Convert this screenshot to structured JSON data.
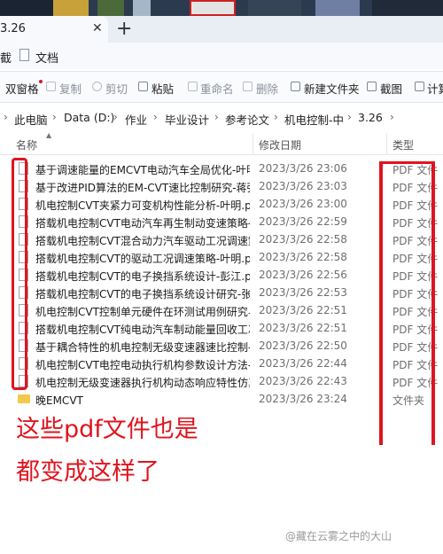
{
  "tab": {
    "title": "3.26",
    "close_glyph": "✕",
    "new_glyph": "+"
  },
  "quick": {
    "item1": "截",
    "item2": "文档"
  },
  "toolbar": {
    "items": [
      {
        "label": "双窗格"
      },
      {
        "label": "复制"
      },
      {
        "label": "剪切"
      },
      {
        "label": "粘贴"
      },
      {
        "label": "重命名"
      },
      {
        "label": "删除"
      },
      {
        "label": "新建文件夹"
      },
      {
        "label": "截图"
      },
      {
        "label": "计算"
      }
    ]
  },
  "address": {
    "parts": [
      "此电脑",
      "Data (D:)",
      "作业",
      "毕业设计",
      "参考论文",
      "机电控制-中",
      "3.26"
    ],
    "separator": "›"
  },
  "columns": {
    "name": "名称",
    "modified": "修改日期",
    "type": "类型"
  },
  "files": [
    {
      "name": "基于调速能量的EMCVT电动汽车全局优化-叶明...",
      "date": "2023/3/26 23:06",
      "type": "PDF 文件"
    },
    {
      "name": "基于改进PID算法的EM-CVT速比控制研究-蒋强...",
      "date": "2023/3/26 23:03",
      "type": "PDF 文件"
    },
    {
      "name": "机电控制CVT夹紧力可变机构性能分析-叶明.pdf",
      "date": "2023/3/26 23:00",
      "type": "PDF 文件"
    },
    {
      "name": "搭载机电控制CVT电动汽车再生制动变速策略-...",
      "date": "2023/3/26 22:59",
      "type": "PDF 文件"
    },
    {
      "name": "搭载机电控制CVT混合动力汽车驱动工况调速策...",
      "date": "2023/3/26 22:58",
      "type": "PDF 文件"
    },
    {
      "name": "搭载机电控制CVT的驱动工况调速策略-叶明.pdf",
      "date": "2023/3/26 22:58",
      "type": "PDF 文件"
    },
    {
      "name": "搭载机电控制CVT的电子换挡系统设计-彭江.pdf",
      "date": "2023/3/26 22:56",
      "type": "PDF 文件"
    },
    {
      "name": "搭载机电控制CVT的电子换挡系统设计研究-张...",
      "date": "2023/3/26 22:53",
      "type": "PDF 文件"
    },
    {
      "name": "机电控制CVT控制单元硬件在环测试用例研究与...",
      "date": "2023/3/26 22:51",
      "type": "PDF 文件"
    },
    {
      "name": "搭载机电控制CVT纯电动汽车制动能量回收工况...",
      "date": "2023/3/26 22:51",
      "type": "PDF 文件"
    },
    {
      "name": "基于耦合特性的机电控制无级变速器速比控制-...",
      "date": "2023/3/26 22:50",
      "type": "PDF 文件"
    },
    {
      "name": "机电控制CVT电控电动执行机构参数设计方法-...",
      "date": "2023/3/26 22:44",
      "type": "PDF 文件"
    },
    {
      "name": "机电控制无级变速器执行机构动态响应特性仿真...",
      "date": "2023/3/26 22:43",
      "type": "PDF 文件"
    },
    {
      "name": "晚EMCVT",
      "date": "2023/3/26 23:24",
      "type": "文件夹",
      "is_folder": true
    }
  ],
  "annotation": {
    "line1": "这些pdf文件也是",
    "line2": "都变成这样了",
    "color": "#e0141e"
  },
  "watermark": "@藏在云雾之中的大山",
  "icons": {
    "close": "close-icon",
    "new_tab": "plus-icon",
    "pdf_file": "pdf-file-icon",
    "folder": "folder-icon"
  }
}
